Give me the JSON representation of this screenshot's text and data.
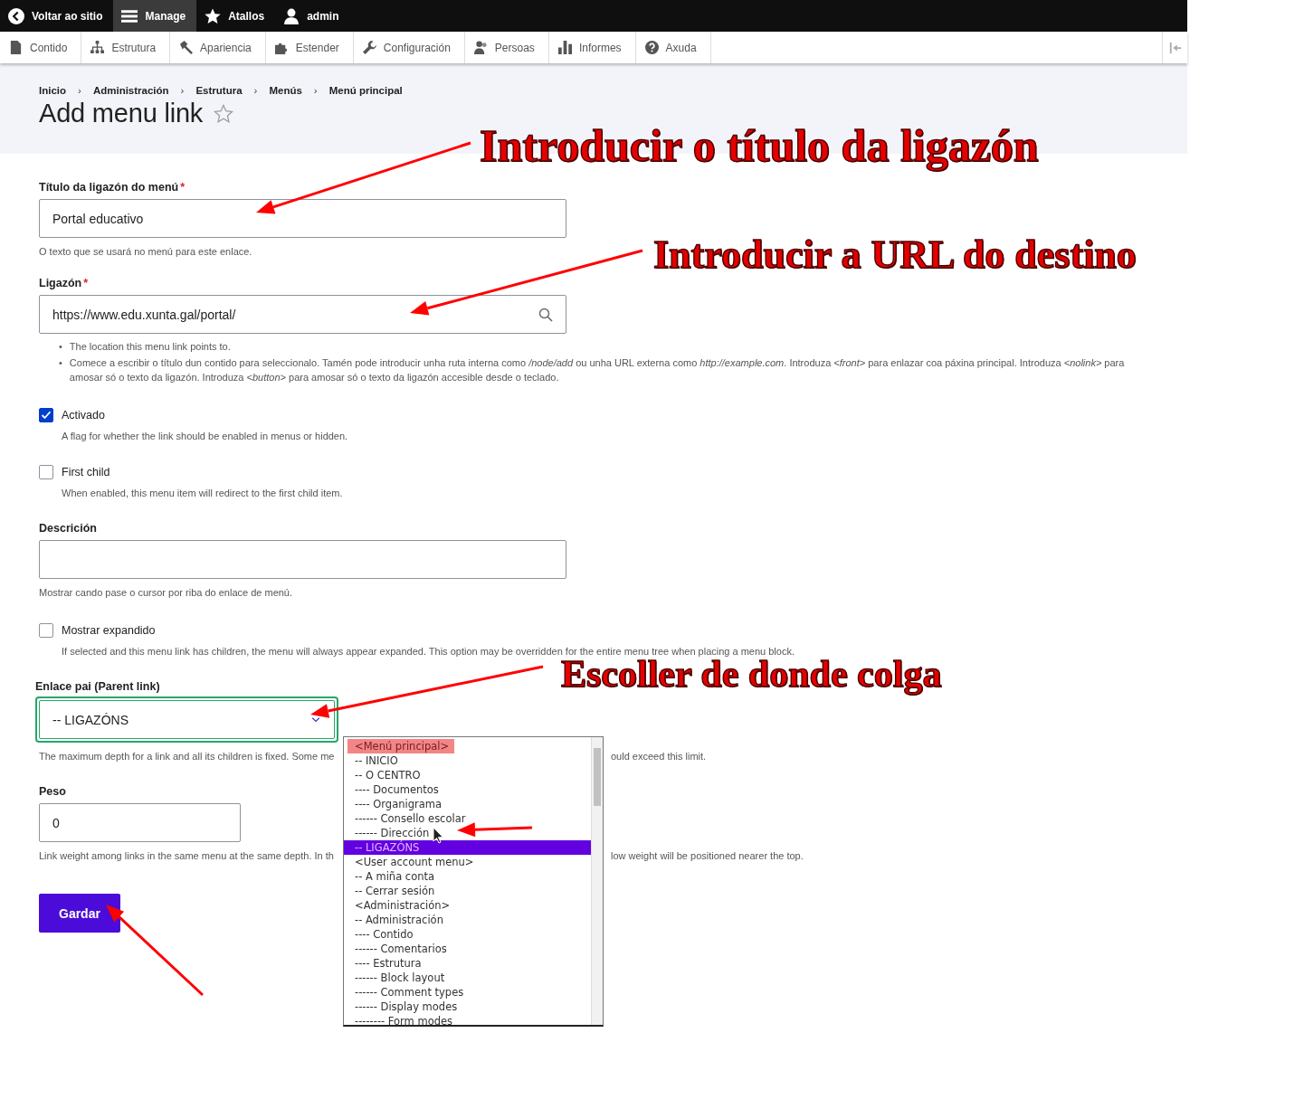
{
  "toolbar": {
    "items": [
      {
        "label": "Voltar ao sitio",
        "selected": false
      },
      {
        "label": "Manage",
        "selected": true
      },
      {
        "label": "Atallos",
        "selected": false
      },
      {
        "label": "admin",
        "selected": false
      }
    ]
  },
  "tray": {
    "items": [
      "Contido",
      "Estrutura",
      "Apariencia",
      "Estender",
      "Configuración",
      "Persoas",
      "Informes",
      "Axuda"
    ]
  },
  "breadcrumb": {
    "separator": "›",
    "items": [
      "Inicio",
      "Administración",
      "Estrutura",
      "Menús",
      "Menú principal"
    ]
  },
  "page_title": "Add menu link",
  "form": {
    "items": [
      {
        "kind": "text",
        "label": "Título da ligazón do menú",
        "required_mark": "*",
        "value": "Portal educativo",
        "descriptions": [
          "O texto que se usará no menú para este enlace."
        ]
      },
      {
        "kind": "link",
        "label": "Ligazón",
        "required_mark": "*",
        "value": "https://www.edu.xunta.gal/portal/",
        "bullet_mark": "•",
        "bullets": [
          "The location this menu link points to.",
          "Comece a escribir o título dun contido para seleccionalo. Tamén pode introducir unha ruta interna como */node/add* ou unha URL externa como *http://example.com*. Introduza *<front>* para enlazar coa páxina principal. Introduza *<nolink>* para amosar só o texto da ligazón. Introduza *<button>* para amosar só o texto da ligazón accesible desde o teclado."
        ]
      },
      {
        "kind": "checkbox",
        "label": "Activado",
        "checked": true,
        "descriptions": [
          "A flag for whether the link should be enabled in menus or hidden."
        ]
      },
      {
        "kind": "checkbox",
        "label": "First child",
        "checked": false,
        "descriptions": [
          "When enabled, this menu item will redirect to the first child item."
        ]
      },
      {
        "kind": "textarea",
        "label": "Descrición",
        "descriptions": [
          "Mostrar cando pase o cursor por riba do enlace de menú."
        ]
      },
      {
        "kind": "checkbox",
        "label": "Mostrar expandido",
        "checked": false,
        "descriptions": [
          "If selected and this menu link has children, the menu will always appear expanded. This option may be overridden for the entire menu tree when placing a menu block."
        ]
      },
      {
        "kind": "select",
        "label": "Enlace pai (Parent link)",
        "value": "-- LIGAZÓNS",
        "focused": true,
        "descriptions": [
          "The maximum depth for a link and all its children is fixed. Some me",
          "ould exceed this limit."
        ],
        "options": [
          {
            "label": "<Menú principal>",
            "selected": false,
            "marked": true
          },
          {
            "label": "-- INICIO",
            "selected": false,
            "marked": false
          },
          {
            "label": "-- O CENTRO",
            "selected": false,
            "marked": false
          },
          {
            "label": "---- Documentos",
            "selected": false,
            "marked": false
          },
          {
            "label": "---- Organigrama",
            "selected": false,
            "marked": false
          },
          {
            "label": "------ Consello escolar",
            "selected": false,
            "marked": false
          },
          {
            "label": "------ Dirección",
            "selected": false,
            "marked": false
          },
          {
            "label": "-- LIGAZÓNS",
            "selected": true,
            "marked": false
          },
          {
            "label": "<User account menu>",
            "selected": false,
            "marked": false
          },
          {
            "label": "-- A miña conta",
            "selected": false,
            "marked": false
          },
          {
            "label": "-- Cerrar sesión",
            "selected": false,
            "marked": false
          },
          {
            "label": "<Administración>",
            "selected": false,
            "marked": false
          },
          {
            "label": "-- Administración",
            "selected": false,
            "marked": false
          },
          {
            "label": "---- Contido",
            "selected": false,
            "marked": false
          },
          {
            "label": "------ Comentarios",
            "selected": false,
            "marked": false
          },
          {
            "label": "---- Estrutura",
            "selected": false,
            "marked": false
          },
          {
            "label": "------ Block layout",
            "selected": false,
            "marked": false
          },
          {
            "label": "------ Comment types",
            "selected": false,
            "marked": false
          },
          {
            "label": "------ Display modes",
            "selected": false,
            "marked": false
          },
          {
            "label": "-------- Form modes",
            "selected": false,
            "marked": false
          }
        ]
      },
      {
        "kind": "number",
        "label": "Peso",
        "value": "0",
        "descriptions": [
          "Link weight among links in the same menu at the same depth. In th",
          "low weight will be positioned nearer the top."
        ]
      },
      {
        "kind": "submit",
        "label": "Gardar"
      }
    ]
  },
  "annotations": [
    "Introducir o título da ligazón",
    "Introducir a URL do destino",
    "Escoller de donde colga"
  ]
}
